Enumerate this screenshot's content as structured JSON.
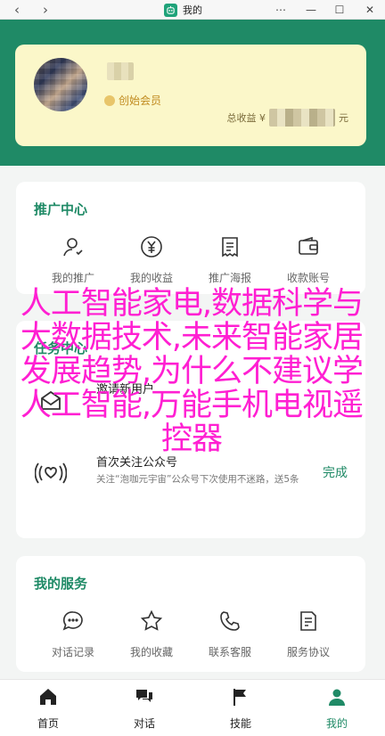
{
  "window": {
    "title": "我的",
    "back_symbol": "‹",
    "forward_symbol": "›",
    "menu_symbol": "⋯",
    "minimize_symbol": "—",
    "maximize_symbol": "☐",
    "close_symbol": "✕"
  },
  "profile": {
    "member_label": "创始会员",
    "earnings_label": "总收益 ¥",
    "earnings_unit": "元"
  },
  "promo": {
    "title": "推广中心",
    "items": [
      {
        "label": "我的推广",
        "icon": "user-icon"
      },
      {
        "label": "我的收益",
        "icon": "yen-icon"
      },
      {
        "label": "推广海报",
        "icon": "poster-icon"
      },
      {
        "label": "收款账号",
        "icon": "wallet-icon"
      }
    ]
  },
  "tasks": {
    "title": "任务中心",
    "items": [
      {
        "title": "邀请新用户",
        "icon": "invite-icon"
      },
      {
        "title": "首次关注公众号",
        "desc": "关注“泡咖元宇宙”公众号下次使用不迷路，送5条",
        "action": "完成",
        "icon": "broadcast-icon"
      }
    ]
  },
  "services": {
    "title": "我的服务",
    "items": [
      {
        "label": "对话记录",
        "icon": "chat-bubble-icon"
      },
      {
        "label": "我的收藏",
        "icon": "star-icon"
      },
      {
        "label": "联系客服",
        "icon": "phone-icon"
      },
      {
        "label": "服务协议",
        "icon": "document-icon"
      }
    ]
  },
  "overlay_text": "人工智能家电,数据科学与大数据技术,未来智能家居发展趋势,为什么不建议学人工智能,万能手机电视遥控器",
  "bottom_nav": [
    {
      "label": "首页",
      "icon": "home-icon",
      "active": false
    },
    {
      "label": "对话",
      "icon": "chat-icon",
      "active": false
    },
    {
      "label": "技能",
      "icon": "flag-icon",
      "active": false
    },
    {
      "label": "我的",
      "icon": "profile-icon",
      "active": true
    }
  ],
  "colors": {
    "accent": "#1f8a66",
    "card_bg": "#fbf7c9",
    "overlay_text": "#ff1fd2",
    "member_gold": "#c08a1e"
  }
}
